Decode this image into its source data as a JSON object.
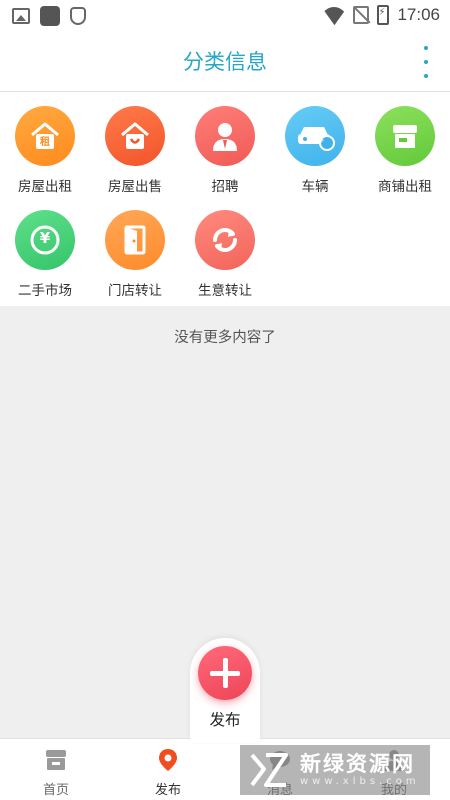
{
  "status_bar": {
    "time": "17:06",
    "icons": [
      "image-icon",
      "app-square-icon",
      "shield-icon",
      "wifi-icon",
      "no-sim-icon",
      "battery-charging-icon"
    ]
  },
  "header": {
    "title": "分类信息",
    "menu_icon": "more-vertical-icon"
  },
  "categories": [
    {
      "label": "房屋出租",
      "icon": "house-rent-icon",
      "badge": "租"
    },
    {
      "label": "房屋出售",
      "icon": "house-sale-icon"
    },
    {
      "label": "招聘",
      "icon": "recruit-person-icon"
    },
    {
      "label": "车辆",
      "icon": "car-icon",
      "badge": "¥"
    },
    {
      "label": "商铺出租",
      "icon": "shop-icon"
    },
    {
      "label": "二手市场",
      "icon": "second-hand-icon",
      "badge": "¥"
    },
    {
      "label": "门店转让",
      "icon": "door-icon"
    },
    {
      "label": "生意转让",
      "icon": "transfer-icon"
    }
  ],
  "empty_message": "没有更多内容了",
  "tabs": [
    {
      "label": "首页",
      "icon": "home-store-icon"
    },
    {
      "label": "发布",
      "icon": "location-pin-icon"
    },
    {
      "label": "消息",
      "icon": "message-icon"
    },
    {
      "label": "我的",
      "icon": "user-icon"
    }
  ],
  "fab": {
    "label": "发布",
    "icon": "plus-icon"
  },
  "watermark": {
    "name": "新绿资源网",
    "url": "www.xlbs.com"
  },
  "colors": {
    "accent": "#26a7c9",
    "active_tab": "#f04e1e",
    "fab": "#ee4458"
  }
}
